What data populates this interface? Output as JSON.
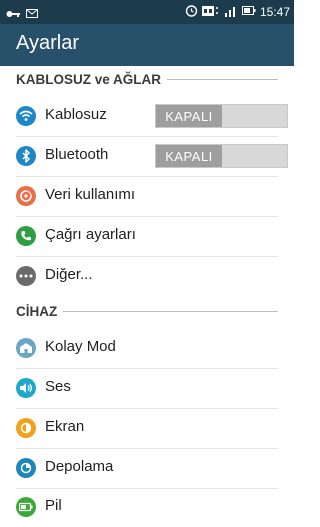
{
  "status_bar": {
    "time": "15:47",
    "left_icons": [
      "vpn-key-icon",
      "email-icon"
    ],
    "right_icons": [
      "alarm-icon",
      "sim-icon",
      "signal-icon",
      "battery-icon"
    ]
  },
  "app_bar": {
    "title": "Ayarlar"
  },
  "sections": {
    "wireless": {
      "title": "KABLOSUZ ve AĞLAR"
    },
    "device": {
      "title": "CİHAZ"
    }
  },
  "items": {
    "wifi": {
      "label": "Kablosuz",
      "toggle": "KAPALI",
      "icon": "wifi-icon",
      "color": "#1e88c7"
    },
    "bluetooth": {
      "label": "Bluetooth",
      "toggle": "KAPALI",
      "icon": "bluetooth-icon",
      "color": "#1e88c7"
    },
    "data": {
      "label": "Veri kullanımı",
      "icon": "data-usage-icon",
      "color": "#e86f4a"
    },
    "call": {
      "label": "Çağrı ayarları",
      "icon": "phone-icon",
      "color": "#2e9f45"
    },
    "more": {
      "label": "Diğer...",
      "icon": "more-icon",
      "color": "#6b6b6b"
    },
    "easy": {
      "label": "Kolay Mod",
      "icon": "easy-mode-icon",
      "color": "#6aa5c4"
    },
    "sound": {
      "label": "Ses",
      "icon": "sound-icon",
      "color": "#1ea9c9"
    },
    "display": {
      "label": "Ekran",
      "icon": "display-icon",
      "color": "#f0a21b"
    },
    "storage": {
      "label": "Depolama",
      "icon": "storage-icon",
      "color": "#1c88b8"
    },
    "battery": {
      "label": "Pil",
      "icon": "battery-icon",
      "color": "#3aa935"
    }
  }
}
